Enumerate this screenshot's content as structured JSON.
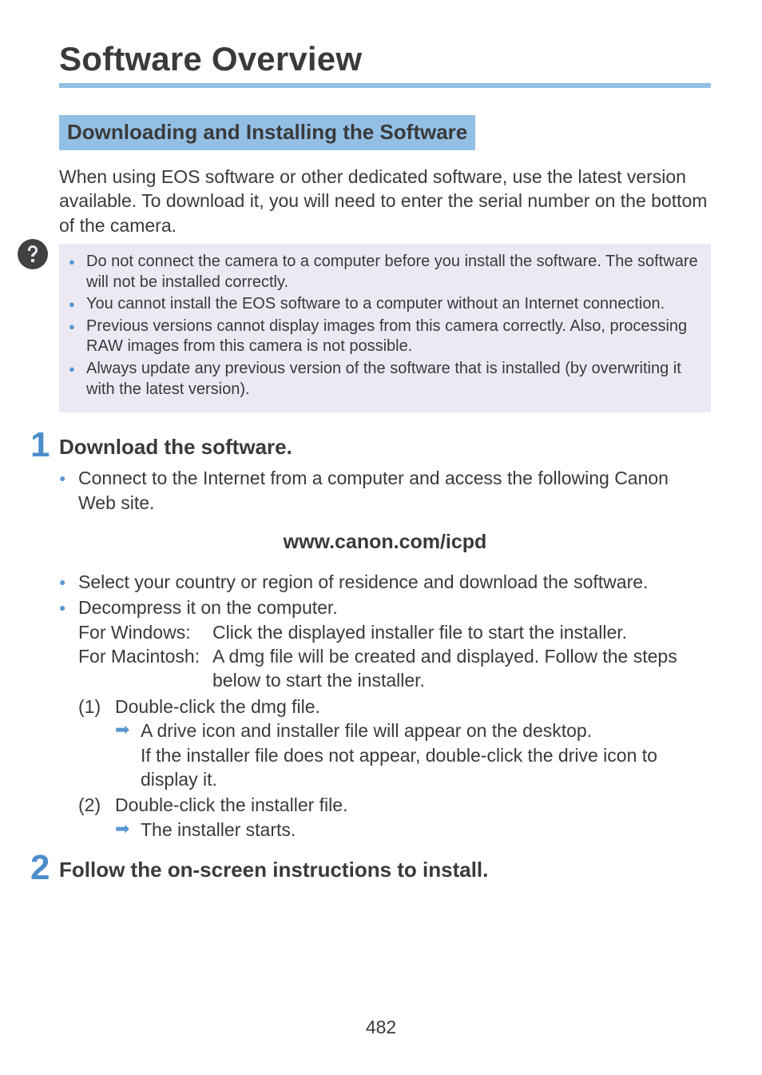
{
  "title": "Software Overview",
  "section_heading": "Downloading and Installing the Software",
  "intro": "When using EOS software or other dedicated software, use the latest version available. To download it, you will need to enter the serial number on the bottom of the camera.",
  "warnings": [
    "Do not connect the camera to a computer before you install the software. The software will not be installed correctly.",
    "You cannot install the EOS software to a computer without an Internet connection.",
    "Previous versions cannot display images from this camera correctly. Also, processing RAW images from this camera is not possible.",
    "Always update any previous version of the software that is installed (by overwriting it with the latest version)."
  ],
  "step1": {
    "number": "1",
    "title": "Download the software.",
    "bullet_connect": "Connect to the Internet from a computer and access the following Canon Web site.",
    "url": "www.canon.com/icpd",
    "bullet_select": "Select your country or region of residence and download the software.",
    "bullet_decompress": "Decompress it on the computer.",
    "win_label": "For Windows:",
    "win_text": "Click the displayed installer file to start the installer.",
    "mac_label": "For Macintosh:",
    "mac_text": "A dmg file will be created and displayed. Follow the steps below to start the installer.",
    "substep1_label": "(1)",
    "substep1_text": "Double-click the dmg file.",
    "substep1_arrow1": "A drive icon and installer file will appear on the desktop.",
    "substep1_arrow1b": "If the installer file does not appear, double-click the drive icon to display it.",
    "substep2_label": "(2)",
    "substep2_text": "Double-click the installer file.",
    "substep2_arrow1": "The installer starts."
  },
  "step2": {
    "number": "2",
    "title": "Follow the on-screen instructions to install."
  },
  "page_number": "482"
}
